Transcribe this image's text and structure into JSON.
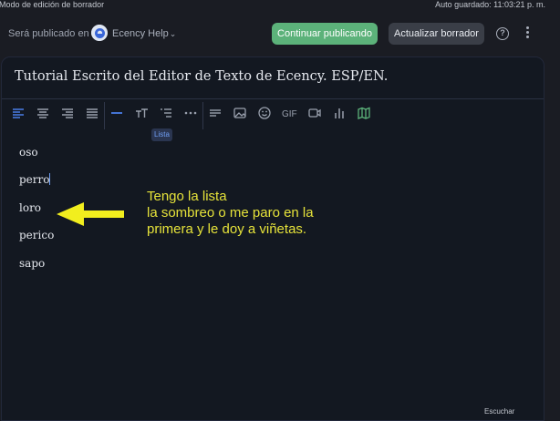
{
  "topbar": {
    "mode": "Modo de edición de borrador",
    "autosave": "Auto guardado: 11:03:21 p. m."
  },
  "publish": {
    "label": "Será publicado en",
    "community": "Ecency Help",
    "caret": "⌄",
    "continue_button": "Continuar publicando",
    "update_button": "Actualizar borrador",
    "help": "?"
  },
  "editor": {
    "title": "Tutorial Escrito del Editor de Texto de Ecency. ESP/EN.",
    "toolbar": {
      "gif_label": "GIF",
      "tooltip": "Lista"
    },
    "list_items": [
      "oso",
      "perro",
      "loro",
      "perico",
      "sapo"
    ]
  },
  "annotation": {
    "lines": [
      "Tengo la lista",
      "la sombreo o me paro en la",
      "primera y le doy a viñetas."
    ],
    "color": "#e6e33a"
  },
  "footer": {
    "text": "Escuchar"
  },
  "colors": {
    "accent_blue": "#4a7ee8",
    "continue_green": "#5cb27a",
    "background": "#1a1c23",
    "editor_bg": "#131821"
  }
}
